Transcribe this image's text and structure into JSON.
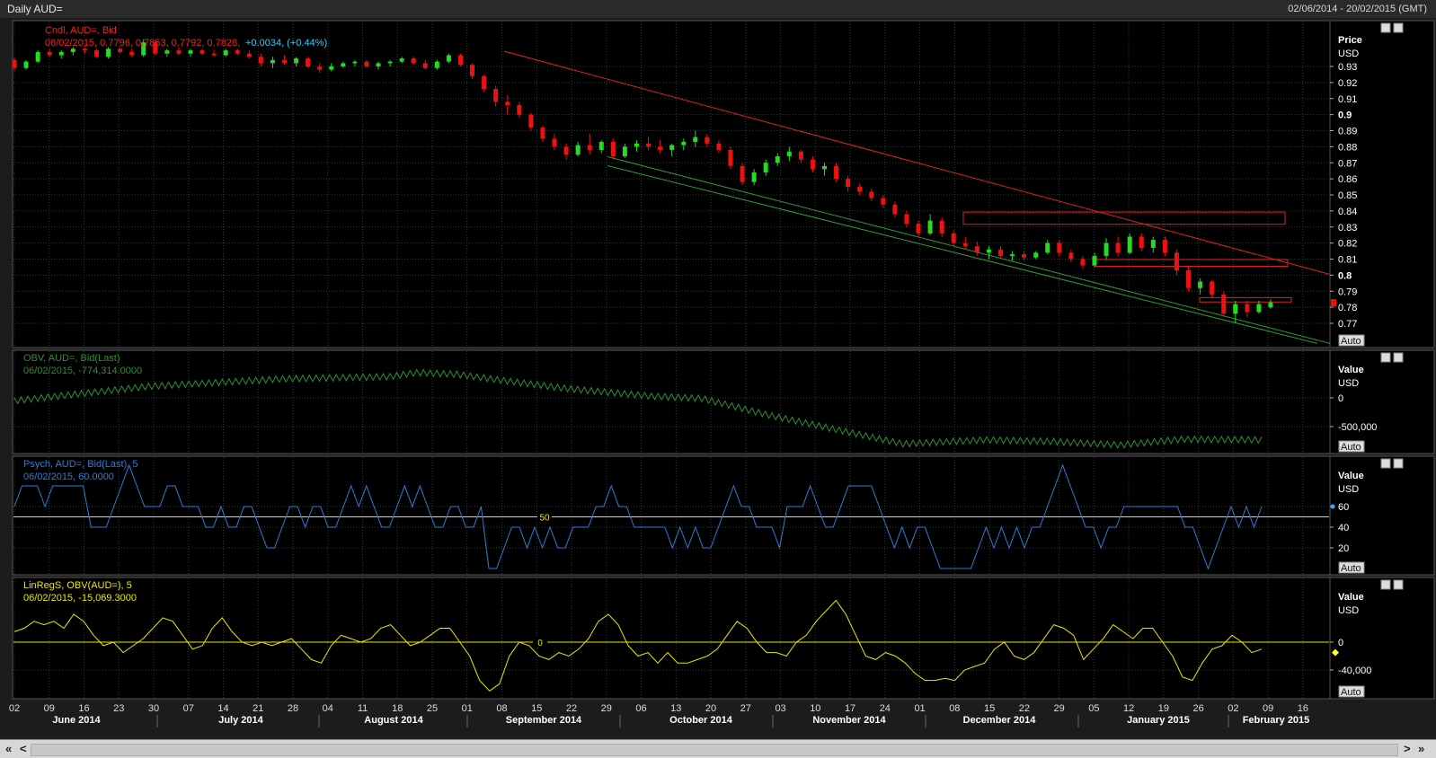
{
  "window": {
    "title": "Daily AUD=",
    "date_range": "02/06/2014 - 20/02/2015 (GMT)"
  },
  "colors": {
    "background": "#000000",
    "grid": "#3a3a3a",
    "up": "#22dd22",
    "down": "#ee1111",
    "obv": "#2f8f2f",
    "psych": "#2a7fd4",
    "linreg": "#e8e800",
    "trend_red": "#dd2222",
    "trend_green": "#2f9a2f"
  },
  "panels": {
    "price": {
      "legend_line1": "Cndl, AUD=, Bid",
      "legend_line2": "06/02/2015, 0.7796, 0.7853, 0.7792, 0.7828,",
      "legend_change": "+0.0034, (+0.44%)",
      "axis_title1": "Price",
      "axis_title2": "USD",
      "auto": "Auto"
    },
    "obv": {
      "legend_line1": "OBV, AUD=, Bid(Last)",
      "legend_line2": "06/02/2015, -774,314.0000",
      "axis_title1": "Value",
      "axis_title2": "USD",
      "auto": "Auto"
    },
    "psych": {
      "legend_line1": "Psych, AUD=, Bid(Last),  5",
      "legend_line2": "06/02/2015, 60.0000",
      "axis_title1": "Value",
      "axis_title2": "USD",
      "ref_label": "50",
      "auto": "Auto"
    },
    "linreg": {
      "legend_line1": "LinRegS, OBV(AUD=),  5",
      "legend_line2": "06/02/2015, -15,069.3000",
      "axis_title1": "Value",
      "axis_title2": "USD",
      "ref_label": "0",
      "auto": "Auto"
    }
  },
  "chart_data": [
    {
      "type": "candlestick",
      "series": [
        {
          "name": "Cndl, AUD=, Bid"
        }
      ],
      "ylim": [
        0.76,
        0.95
      ],
      "y_ticks": [
        "0.93",
        "0.92",
        "0.91",
        "0.9",
        "0.89",
        "0.88",
        "0.87",
        "0.86",
        "0.85",
        "0.84",
        "0.83",
        "0.82",
        "0.81",
        "0.8",
        "0.79",
        "0.78",
        "0.77"
      ],
      "ohlc_every_2_days": [
        [
          0.934,
          0.936,
          0.927,
          0.929
        ],
        [
          0.929,
          0.934,
          0.928,
          0.933
        ],
        [
          0.933,
          0.94,
          0.932,
          0.939
        ],
        [
          0.939,
          0.941,
          0.936,
          0.937
        ],
        [
          0.937,
          0.94,
          0.935,
          0.939
        ],
        [
          0.939,
          0.942,
          0.937,
          0.941
        ],
        [
          0.941,
          0.942,
          0.938,
          0.94
        ],
        [
          0.94,
          0.941,
          0.935,
          0.936
        ],
        [
          0.936,
          0.942,
          0.935,
          0.941
        ],
        [
          0.941,
          0.942,
          0.938,
          0.939
        ],
        [
          0.939,
          0.941,
          0.936,
          0.937
        ],
        [
          0.937,
          0.947,
          0.936,
          0.945
        ],
        [
          0.945,
          0.946,
          0.937,
          0.938
        ],
        [
          0.938,
          0.941,
          0.936,
          0.94
        ],
        [
          0.94,
          0.942,
          0.937,
          0.938
        ],
        [
          0.938,
          0.941,
          0.936,
          0.94
        ],
        [
          0.94,
          0.941,
          0.937,
          0.938
        ],
        [
          0.938,
          0.94,
          0.936,
          0.937
        ],
        [
          0.937,
          0.941,
          0.936,
          0.94
        ],
        [
          0.94,
          0.941,
          0.937,
          0.938
        ],
        [
          0.938,
          0.94,
          0.935,
          0.936
        ],
        [
          0.936,
          0.938,
          0.93,
          0.932
        ],
        [
          0.932,
          0.936,
          0.929,
          0.934
        ],
        [
          0.934,
          0.937,
          0.931,
          0.932
        ],
        [
          0.932,
          0.936,
          0.93,
          0.935
        ],
        [
          0.935,
          0.936,
          0.929,
          0.93
        ],
        [
          0.93,
          0.932,
          0.926,
          0.928
        ],
        [
          0.928,
          0.932,
          0.927,
          0.93
        ],
        [
          0.93,
          0.933,
          0.929,
          0.932
        ],
        [
          0.932,
          0.934,
          0.93,
          0.933
        ],
        [
          0.933,
          0.934,
          0.929,
          0.93
        ],
        [
          0.93,
          0.933,
          0.928,
          0.932
        ],
        [
          0.932,
          0.934,
          0.93,
          0.933
        ],
        [
          0.933,
          0.936,
          0.932,
          0.935
        ],
        [
          0.935,
          0.936,
          0.931,
          0.932
        ],
        [
          0.932,
          0.934,
          0.928,
          0.929
        ],
        [
          0.929,
          0.934,
          0.928,
          0.933
        ],
        [
          0.933,
          0.938,
          0.932,
          0.937
        ],
        [
          0.937,
          0.938,
          0.93,
          0.931
        ],
        [
          0.931,
          0.932,
          0.922,
          0.924
        ],
        [
          0.924,
          0.925,
          0.914,
          0.916
        ],
        [
          0.916,
          0.918,
          0.905,
          0.908
        ],
        [
          0.908,
          0.912,
          0.9,
          0.906
        ],
        [
          0.906,
          0.908,
          0.898,
          0.9
        ],
        [
          0.9,
          0.901,
          0.89,
          0.892
        ],
        [
          0.892,
          0.893,
          0.883,
          0.885
        ],
        [
          0.885,
          0.888,
          0.878,
          0.88
        ],
        [
          0.88,
          0.882,
          0.872,
          0.875
        ],
        [
          0.875,
          0.883,
          0.874,
          0.881
        ],
        [
          0.881,
          0.888,
          0.875,
          0.878
        ],
        [
          0.878,
          0.884,
          0.876,
          0.883
        ],
        [
          0.883,
          0.885,
          0.872,
          0.874
        ],
        [
          0.874,
          0.882,
          0.873,
          0.88
        ],
        [
          0.88,
          0.884,
          0.877,
          0.882
        ],
        [
          0.882,
          0.886,
          0.878,
          0.88
        ],
        [
          0.88,
          0.884,
          0.876,
          0.878
        ],
        [
          0.878,
          0.882,
          0.874,
          0.881
        ],
        [
          0.881,
          0.885,
          0.878,
          0.883
        ],
        [
          0.883,
          0.89,
          0.88,
          0.886
        ],
        [
          0.886,
          0.888,
          0.88,
          0.882
        ],
        [
          0.882,
          0.884,
          0.876,
          0.878
        ],
        [
          0.878,
          0.88,
          0.866,
          0.868
        ],
        [
          0.868,
          0.87,
          0.856,
          0.858
        ],
        [
          0.858,
          0.866,
          0.856,
          0.864
        ],
        [
          0.864,
          0.872,
          0.862,
          0.87
        ],
        [
          0.87,
          0.876,
          0.868,
          0.874
        ],
        [
          0.874,
          0.88,
          0.871,
          0.877
        ],
        [
          0.877,
          0.878,
          0.87,
          0.872
        ],
        [
          0.872,
          0.874,
          0.864,
          0.866
        ],
        [
          0.866,
          0.87,
          0.862,
          0.868
        ],
        [
          0.868,
          0.87,
          0.858,
          0.86
        ],
        [
          0.86,
          0.862,
          0.852,
          0.855
        ],
        [
          0.855,
          0.857,
          0.85,
          0.852
        ],
        [
          0.852,
          0.854,
          0.846,
          0.848
        ],
        [
          0.848,
          0.85,
          0.842,
          0.844
        ],
        [
          0.844,
          0.846,
          0.836,
          0.838
        ],
        [
          0.838,
          0.84,
          0.83,
          0.832
        ],
        [
          0.832,
          0.834,
          0.824,
          0.826
        ],
        [
          0.826,
          0.838,
          0.825,
          0.834
        ],
        [
          0.834,
          0.836,
          0.824,
          0.826
        ],
        [
          0.826,
          0.828,
          0.818,
          0.82
        ],
        [
          0.82,
          0.824,
          0.816,
          0.818
        ],
        [
          0.818,
          0.821,
          0.812,
          0.814
        ],
        [
          0.814,
          0.818,
          0.81,
          0.816
        ],
        [
          0.816,
          0.818,
          0.811,
          0.812
        ],
        [
          0.812,
          0.815,
          0.809,
          0.813
        ],
        [
          0.813,
          0.815,
          0.809,
          0.811
        ],
        [
          0.811,
          0.815,
          0.81,
          0.814
        ],
        [
          0.814,
          0.822,
          0.813,
          0.82
        ],
        [
          0.82,
          0.822,
          0.812,
          0.814
        ],
        [
          0.814,
          0.816,
          0.808,
          0.81
        ],
        [
          0.81,
          0.812,
          0.804,
          0.806
        ],
        [
          0.806,
          0.814,
          0.805,
          0.812
        ],
        [
          0.812,
          0.823,
          0.81,
          0.82
        ],
        [
          0.82,
          0.824,
          0.812,
          0.814
        ],
        [
          0.814,
          0.826,
          0.813,
          0.824
        ],
        [
          0.824,
          0.826,
          0.815,
          0.817
        ],
        [
          0.817,
          0.824,
          0.814,
          0.822
        ],
        [
          0.822,
          0.824,
          0.812,
          0.814
        ],
        [
          0.814,
          0.816,
          0.8,
          0.803
        ],
        [
          0.803,
          0.806,
          0.79,
          0.792
        ],
        [
          0.792,
          0.798,
          0.788,
          0.796
        ],
        [
          0.796,
          0.797,
          0.786,
          0.788
        ],
        [
          0.788,
          0.79,
          0.774,
          0.776
        ],
        [
          0.776,
          0.784,
          0.77,
          0.782
        ],
        [
          0.782,
          0.784,
          0.774,
          0.777
        ],
        [
          0.777,
          0.784,
          0.776,
          0.782
        ],
        [
          0.78,
          0.785,
          0.779,
          0.783
        ]
      ],
      "trendlines": "red descending resistance line from early September high; two green parallel support lines; red rectangles marking zones"
    },
    {
      "type": "line",
      "series": [
        {
          "name": "OBV, AUD=, Bid(Last)"
        }
      ],
      "y_ticks": [
        "0",
        "-500,000"
      ],
      "last_value": -774314.0
    },
    {
      "type": "line",
      "series": [
        {
          "name": "Psych, AUD=, Bid(Last),  5"
        }
      ],
      "y_ticks": [
        "60",
        "40",
        "20"
      ],
      "reference": 50,
      "last_value": 60.0
    },
    {
      "type": "line",
      "series": [
        {
          "name": "LinRegS, OBV(AUD=),  5"
        }
      ],
      "y_ticks": [
        "0",
        "-40,000"
      ],
      "reference": 0,
      "last_value": -15069.3
    }
  ],
  "x_axis": {
    "day_ticks": [
      "02",
      "09",
      "16",
      "23",
      "30",
      "07",
      "14",
      "21",
      "28",
      "04",
      "11",
      "18",
      "25",
      "01",
      "08",
      "15",
      "22",
      "29",
      "06",
      "13",
      "20",
      "27",
      "03",
      "10",
      "17",
      "24",
      "01",
      "08",
      "15",
      "22",
      "29",
      "05",
      "12",
      "19",
      "26",
      "02",
      "09",
      "16"
    ],
    "months": [
      "June 2014",
      "July 2014",
      "August 2014",
      "September 2014",
      "October 2014",
      "November 2014",
      "December 2014",
      "January 2015",
      "February 2015"
    ]
  },
  "scrollbar": {
    "left": "«",
    "prev": "<",
    "next": ">",
    "right": "»"
  }
}
